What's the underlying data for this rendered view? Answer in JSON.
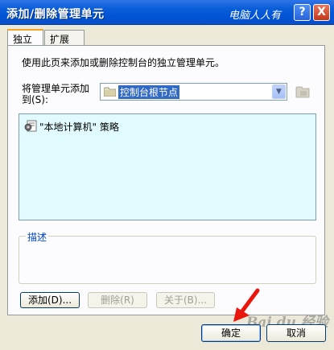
{
  "window": {
    "title": "添加/删除管理单元",
    "watermark_text": "电脑人人有",
    "help_label": "?",
    "close_label": "X"
  },
  "tabs": [
    {
      "label": "独立",
      "active": true
    },
    {
      "label": "扩展",
      "active": false
    }
  ],
  "standalone": {
    "description": "使用此页来添加或删除控制台的独立管理单元。",
    "add_to_label": "将管理单元添加到(S):",
    "add_to_label_line1": "将管理单元添加",
    "add_to_label_line2": "到(S):",
    "add_to_value": "控制台根节点"
  },
  "snapins": [
    {
      "label": "\"本地计算机\" 策略",
      "icon": "policy-icon"
    }
  ],
  "description_group": {
    "title": "描述"
  },
  "buttons": {
    "add": "添加(D)...",
    "remove": "删除(R)",
    "about": "关于(B)...",
    "ok": "确定",
    "cancel": "取消"
  },
  "overlay": {
    "watermark_text": "Bai du 经验"
  },
  "colors": {
    "titlebar": "#0053d6",
    "list_background": "#e0fafd",
    "selection": "#316ac5",
    "arrow": "#e8160c"
  }
}
